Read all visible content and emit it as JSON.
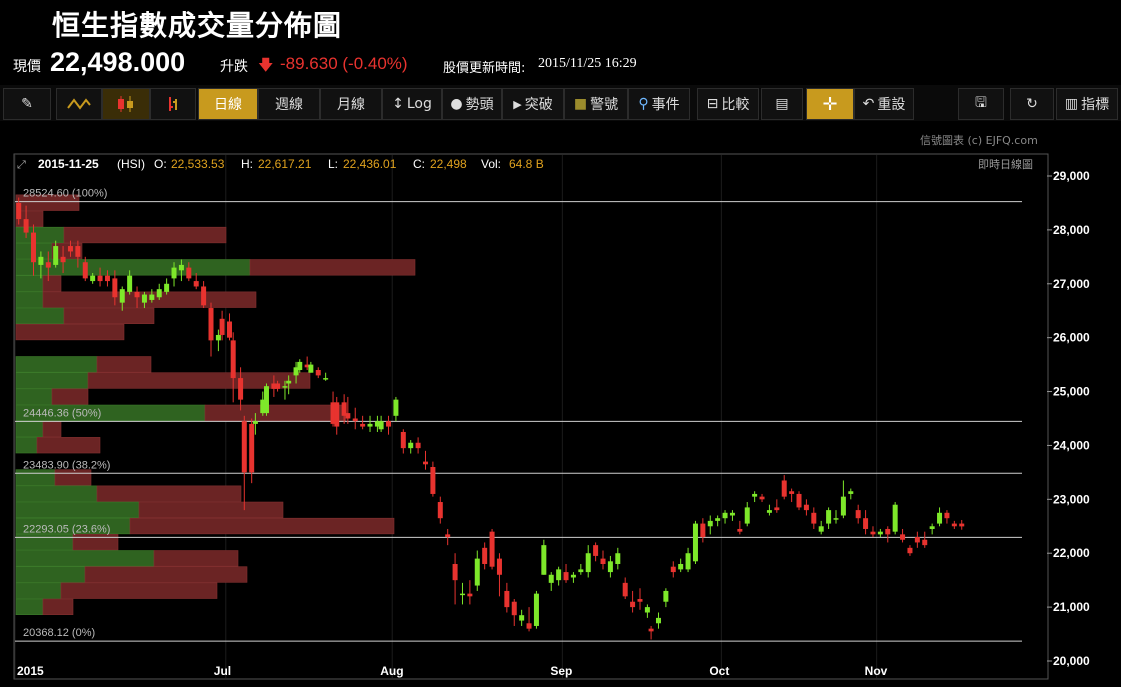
{
  "header": {
    "title": "恒生指數成交量分佈圖"
  },
  "quote": {
    "price_label": "現價",
    "price": "22,498.000",
    "change_label": "升跌",
    "change": "-89.630 (-0.40%)",
    "update_label": "股價更新時間:",
    "update_time": "2015/11/25 16:29"
  },
  "toolbar": {
    "items": [
      {
        "name": "draw",
        "label": "",
        "icon": "pencil-icon"
      },
      {
        "name": "line-chart",
        "label": "",
        "icon": "line-chart-icon"
      },
      {
        "name": "candle-chart",
        "label": "",
        "icon": "candlestick-icon"
      },
      {
        "name": "ohlc-chart",
        "label": "",
        "icon": "ohlc-icon"
      },
      {
        "name": "daily",
        "label": "日線"
      },
      {
        "name": "weekly",
        "label": "週線"
      },
      {
        "name": "monthly",
        "label": "月線"
      },
      {
        "name": "log",
        "label": "Log",
        "icon": "vertical-arrows-icon"
      },
      {
        "name": "trend",
        "label": "勢頭",
        "icon": "circle-icon"
      },
      {
        "name": "breakout",
        "label": "突破",
        "icon": "triangle-right-icon"
      },
      {
        "name": "alert",
        "label": "警號",
        "icon": "square-icon"
      },
      {
        "name": "event",
        "label": "事件",
        "icon": "pin-icon"
      },
      {
        "name": "compare",
        "label": "比較",
        "icon": "compare-icon"
      },
      {
        "name": "doc",
        "label": "",
        "icon": "document-icon"
      },
      {
        "name": "crosshair",
        "label": "",
        "icon": "crosshair-icon"
      },
      {
        "name": "reset",
        "label": "重設",
        "icon": "undo-icon"
      },
      {
        "name": "save",
        "label": "",
        "icon": "save-icon"
      },
      {
        "name": "refresh",
        "label": "",
        "icon": "refresh-icon"
      },
      {
        "name": "indicator",
        "label": "指標",
        "icon": "list-icon"
      }
    ]
  },
  "credit": "信號圖表 (c) EJFQ.com",
  "chart_data": {
    "type": "candlestick",
    "symbol": "(HSI)",
    "info": {
      "date": "2015-11-25",
      "o_label": "O:",
      "open": "22,533.53",
      "h_label": "H:",
      "high": "22,617.21",
      "l_label": "L:",
      "low": "22,436.01",
      "c_label": "C:",
      "close": "22,498",
      "vol_label": "Vol:",
      "vol": "64.8 B"
    },
    "corner_label": "即時日線圖",
    "ylim": [
      19950,
      29300
    ],
    "yticks": [
      "29,000",
      "28,000",
      "27,000",
      "26,000",
      "25,000",
      "24,000",
      "23,000",
      "22,000",
      "21,000",
      "20,000"
    ],
    "ytick_values": [
      29000,
      28000,
      27000,
      26000,
      25000,
      24000,
      23000,
      22000,
      21000,
      20000
    ],
    "xticks": [
      {
        "label": "2015",
        "x": 0
      },
      {
        "label": "Jul",
        "x": 57
      },
      {
        "label": "Aug",
        "x": 102
      },
      {
        "label": "Sep",
        "x": 148
      },
      {
        "label": "Oct",
        "x": 191
      },
      {
        "label": "Nov",
        "x": 233
      }
    ],
    "x_range": [
      0,
      275
    ],
    "fib_levels": [
      {
        "label": "28524.60 (100%)",
        "value": 28524.6
      },
      {
        "label": "24446.36 (50%)",
        "value": 24446.36
      },
      {
        "label": "23483.90 (38.2%)",
        "value": 23483.9
      },
      {
        "label": "22293.05 (23.6%)",
        "value": 22293.05
      },
      {
        "label": "20368.12 (0%)",
        "value": 20368.12
      }
    ],
    "volume_profile": [
      {
        "lo": 28350,
        "hi": 28650,
        "up": 0,
        "down": 21
      },
      {
        "lo": 28050,
        "hi": 28350,
        "up": 0,
        "down": 9
      },
      {
        "lo": 27750,
        "hi": 28050,
        "up": 16,
        "down": 54
      },
      {
        "lo": 27450,
        "hi": 27750,
        "up": 12,
        "down": 10
      },
      {
        "lo": 27150,
        "hi": 27450,
        "up": 78,
        "down": 55
      },
      {
        "lo": 26850,
        "hi": 27150,
        "up": 9,
        "down": 6
      },
      {
        "lo": 26550,
        "hi": 26850,
        "up": 9,
        "down": 71
      },
      {
        "lo": 26250,
        "hi": 26550,
        "up": 16,
        "down": 30
      },
      {
        "lo": 25950,
        "hi": 26250,
        "up": 0,
        "down": 36
      },
      {
        "lo": 25650,
        "hi": 25950,
        "up": 0,
        "down": 0
      },
      {
        "lo": 25350,
        "hi": 25650,
        "up": 27,
        "down": 18
      },
      {
        "lo": 25050,
        "hi": 25350,
        "up": 24,
        "down": 74
      },
      {
        "lo": 24750,
        "hi": 25050,
        "up": 12,
        "down": 12
      },
      {
        "lo": 24450,
        "hi": 24750,
        "up": 63,
        "down": 47
      },
      {
        "lo": 24150,
        "hi": 24450,
        "up": 9,
        "down": 6
      },
      {
        "lo": 23850,
        "hi": 24150,
        "up": 7,
        "down": 21
      },
      {
        "lo": 23550,
        "hi": 23850,
        "up": 0,
        "down": 0
      },
      {
        "lo": 23250,
        "hi": 23550,
        "up": 13,
        "down": 12
      },
      {
        "lo": 22950,
        "hi": 23250,
        "up": 27,
        "down": 48
      },
      {
        "lo": 22650,
        "hi": 22950,
        "up": 41,
        "down": 48
      },
      {
        "lo": 22350,
        "hi": 22650,
        "up": 38,
        "down": 88
      },
      {
        "lo": 22050,
        "hi": 22350,
        "up": 19,
        "down": 15
      },
      {
        "lo": 21750,
        "hi": 22050,
        "up": 46,
        "down": 28
      },
      {
        "lo": 21450,
        "hi": 21750,
        "up": 23,
        "down": 54
      },
      {
        "lo": 21150,
        "hi": 21450,
        "up": 15,
        "down": 52
      },
      {
        "lo": 20850,
        "hi": 21150,
        "up": 9,
        "down": 10
      },
      {
        "lo": 20550,
        "hi": 20850,
        "up": 0,
        "down": 0
      }
    ],
    "candles": [
      [
        1,
        28500,
        28600,
        28100,
        28200
      ],
      [
        3,
        28200,
        28450,
        27850,
        27950
      ],
      [
        5,
        27950,
        28100,
        27150,
        27400
      ],
      [
        7,
        27350,
        27600,
        27100,
        27500
      ],
      [
        9,
        27400,
        27600,
        27050,
        27300
      ],
      [
        11,
        27350,
        27800,
        27300,
        27700
      ],
      [
        13,
        27500,
        27700,
        27200,
        27400
      ],
      [
        15,
        27700,
        27800,
        27500,
        27600
      ],
      [
        17,
        27700,
        27800,
        27300,
        27500
      ],
      [
        19,
        27400,
        27500,
        27050,
        27100
      ],
      [
        21,
        27050,
        27200,
        27000,
        27150
      ],
      [
        23,
        27150,
        27300,
        26950,
        27050
      ],
      [
        25,
        27150,
        27250,
        26950,
        27050
      ],
      [
        27,
        27100,
        27250,
        26600,
        26750
      ],
      [
        29,
        26650,
        26950,
        26500,
        26900
      ],
      [
        31,
        26850,
        27250,
        26800,
        27150
      ],
      [
        33,
        26850,
        26950,
        26550,
        26750
      ],
      [
        35,
        26650,
        26850,
        26550,
        26800
      ],
      [
        37,
        26700,
        26900,
        26650,
        26800
      ],
      [
        39,
        26750,
        27000,
        26700,
        26900
      ],
      [
        41,
        26850,
        27100,
        26800,
        27000
      ],
      [
        43,
        27100,
        27400,
        26950,
        27300
      ],
      [
        45,
        27250,
        27450,
        27050,
        27350
      ],
      [
        47,
        27300,
        27400,
        27050,
        27100
      ],
      [
        49,
        27050,
        27200,
        26900,
        26950
      ],
      [
        51,
        26950,
        27050,
        26550,
        26600
      ],
      [
        53,
        26550,
        26650,
        25650,
        25950
      ],
      [
        55,
        25950,
        26150,
        25750,
        26050
      ],
      [
        56,
        26350,
        26500,
        25950,
        26050
      ],
      [
        58,
        26300,
        26450,
        25950,
        26000
      ],
      [
        59,
        25950,
        26100,
        24800,
        25250
      ],
      [
        61,
        25250,
        25450,
        24650,
        24850
      ],
      [
        62,
        24450,
        24550,
        22800,
        23500
      ],
      [
        64,
        24400,
        24500,
        23300,
        23500
      ],
      [
        65,
        24400,
        24600,
        24200,
        24450
      ],
      [
        67,
        24600,
        25000,
        24550,
        24850
      ],
      [
        68,
        24600,
        25150,
        24550,
        25100
      ],
      [
        70,
        25150,
        25300,
        24900,
        25050
      ],
      [
        71,
        25150,
        25200,
        25000,
        25050
      ],
      [
        73,
        25100,
        25200,
        24850,
        25100
      ],
      [
        74,
        25150,
        25300,
        24950,
        25200
      ],
      [
        76,
        25300,
        25550,
        25150,
        25450
      ],
      [
        77,
        25400,
        25600,
        25350,
        25550
      ],
      [
        79,
        25500,
        25650,
        25400,
        25450
      ],
      [
        80,
        25350,
        25550,
        25350,
        25500
      ],
      [
        82,
        25400,
        25450,
        25250,
        25300
      ],
      [
        84,
        25250,
        25350,
        25200,
        25250
      ],
      [
        86,
        24800,
        25000,
        24350,
        24400
      ],
      [
        87,
        24800,
        24900,
        24200,
        24350
      ],
      [
        89,
        24800,
        24950,
        24400,
        24550
      ],
      [
        90,
        24600,
        24900,
        24400,
        24500
      ],
      [
        92,
        24500,
        24700,
        24300,
        24450
      ],
      [
        94,
        24400,
        24550,
        24300,
        24350
      ],
      [
        96,
        24350,
        24550,
        24250,
        24400
      ],
      [
        98,
        24350,
        24550,
        24250,
        24450
      ],
      [
        99,
        24300,
        24550,
        24250,
        24450
      ],
      [
        101,
        24450,
        24550,
        24200,
        24350
      ],
      [
        103,
        24550,
        24900,
        24450,
        24850
      ],
      [
        105,
        24250,
        24300,
        23850,
        23950
      ],
      [
        107,
        23950,
        24100,
        23850,
        24050
      ],
      [
        109,
        24050,
        24150,
        23850,
        23950
      ],
      [
        111,
        23700,
        23900,
        23550,
        23650
      ],
      [
        113,
        23600,
        23700,
        23050,
        23100
      ],
      [
        115,
        22950,
        23050,
        22550,
        22650
      ],
      [
        117,
        22350,
        22450,
        22150,
        22300
      ],
      [
        119,
        21800,
        22000,
        21050,
        21500
      ],
      [
        121,
        21250,
        21450,
        21050,
        21250
      ],
      [
        123,
        21250,
        21500,
        21050,
        21200
      ],
      [
        125,
        21400,
        22050,
        21300,
        21900
      ],
      [
        127,
        22100,
        22200,
        21700,
        21800
      ],
      [
        129,
        22400,
        22450,
        21700,
        21750
      ],
      [
        131,
        21900,
        22000,
        21200,
        21600
      ],
      [
        133,
        21300,
        21450,
        20900,
        21000
      ],
      [
        135,
        21100,
        21150,
        20650,
        20850
      ],
      [
        137,
        20750,
        20950,
        20650,
        20850
      ],
      [
        139,
        20700,
        21000,
        20550,
        20600
      ],
      [
        141,
        20650,
        21300,
        20600,
        21250
      ],
      [
        143,
        21600,
        22250,
        21600,
        22150
      ],
      [
        145,
        21450,
        21650,
        21300,
        21600
      ],
      [
        147,
        21500,
        21750,
        21400,
        21700
      ],
      [
        149,
        21650,
        21800,
        21450,
        21500
      ],
      [
        151,
        21550,
        21650,
        21450,
        21600
      ],
      [
        153,
        21650,
        21800,
        21600,
        21700
      ],
      [
        155,
        21650,
        22150,
        21550,
        22000
      ],
      [
        157,
        22150,
        22200,
        21850,
        21950
      ],
      [
        159,
        21900,
        22050,
        21700,
        21800
      ],
      [
        161,
        21650,
        21950,
        21550,
        21850
      ],
      [
        163,
        21800,
        22100,
        21700,
        22000
      ],
      [
        165,
        21450,
        21550,
        21150,
        21200
      ],
      [
        167,
        21100,
        21300,
        20900,
        21000
      ],
      [
        169,
        21150,
        21350,
        20950,
        21100
      ],
      [
        171,
        20900,
        21050,
        20800,
        21000
      ],
      [
        172,
        20600,
        20650,
        20400,
        20550
      ],
      [
        174,
        20700,
        20900,
        20600,
        20800
      ],
      [
        176,
        21100,
        21350,
        21000,
        21300
      ],
      [
        178,
        21750,
        21850,
        21550,
        21650
      ],
      [
        180,
        21700,
        21900,
        21650,
        21800
      ],
      [
        182,
        21700,
        22100,
        21650,
        22000
      ],
      [
        184,
        21850,
        22600,
        21800,
        22550
      ],
      [
        186,
        22550,
        22650,
        22200,
        22300
      ],
      [
        188,
        22500,
        22700,
        22350,
        22600
      ],
      [
        190,
        22600,
        22700,
        22500,
        22650
      ],
      [
        192,
        22650,
        22800,
        22550,
        22750
      ],
      [
        194,
        22700,
        22800,
        22600,
        22750
      ],
      [
        196,
        22450,
        22600,
        22350,
        22400
      ],
      [
        198,
        22550,
        22950,
        22500,
        22850
      ],
      [
        200,
        23050,
        23150,
        22950,
        23100
      ],
      [
        202,
        23050,
        23100,
        22950,
        23000
      ],
      [
        204,
        22750,
        22900,
        22700,
        22800
      ],
      [
        206,
        22850,
        23000,
        22750,
        22800
      ],
      [
        208,
        23350,
        23450,
        23000,
        23050
      ],
      [
        210,
        23150,
        23200,
        22950,
        23100
      ],
      [
        212,
        23100,
        23150,
        22800,
        22850
      ],
      [
        214,
        22900,
        23000,
        22700,
        22800
      ],
      [
        216,
        22750,
        22850,
        22450,
        22550
      ],
      [
        218,
        22400,
        22600,
        22350,
        22500
      ],
      [
        220,
        22550,
        22850,
        22450,
        22800
      ],
      [
        222,
        22650,
        22800,
        22550,
        22650
      ],
      [
        224,
        22700,
        23350,
        22650,
        23050
      ],
      [
        226,
        23100,
        23200,
        23000,
        23150
      ],
      [
        228,
        22800,
        22900,
        22550,
        22650
      ],
      [
        230,
        22650,
        22800,
        22350,
        22450
      ],
      [
        232,
        22400,
        22500,
        22300,
        22350
      ],
      [
        234,
        22350,
        22450,
        22300,
        22400
      ],
      [
        236,
        22450,
        22500,
        22200,
        22350
      ],
      [
        238,
        22400,
        22950,
        22350,
        22900
      ],
      [
        240,
        22350,
        22450,
        22200,
        22250
      ],
      [
        242,
        22100,
        22150,
        21950,
        22000
      ],
      [
        244,
        22300,
        22400,
        22100,
        22200
      ],
      [
        246,
        22250,
        22400,
        22100,
        22150
      ],
      [
        248,
        22450,
        22550,
        22350,
        22500
      ],
      [
        250,
        22550,
        22850,
        22500,
        22750
      ],
      [
        252,
        22750,
        22800,
        22550,
        22650
      ],
      [
        254,
        22550,
        22600,
        22450,
        22500
      ],
      [
        256,
        22550,
        22617,
        22436,
        22498
      ]
    ]
  },
  "colors": {
    "up": "#7ee82a",
    "down": "#e8332f",
    "vol_up": "#2f6320",
    "vol_down": "#6b2424",
    "vol_up_border": "#3c7a2a",
    "vol_down_border": "#823030",
    "accent": "#c89a1e"
  }
}
